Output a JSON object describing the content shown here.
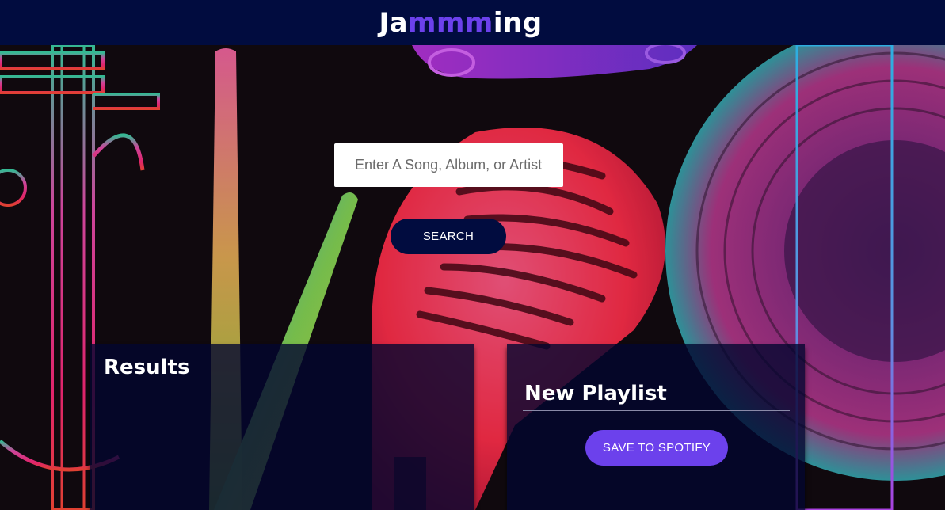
{
  "header": {
    "brand_prefix": "Ja",
    "brand_accent": "mmm",
    "brand_suffix": "ing",
    "background_color": "#010c3f",
    "accent_color": "#6c41ec"
  },
  "search": {
    "placeholder": "Enter A Song, Album, or Artist",
    "value": "",
    "button_label": "SEARCH"
  },
  "results": {
    "title": "Results",
    "tracks": []
  },
  "playlist": {
    "name_value": "New Playlist",
    "tracks": [],
    "save_label": "SAVE TO SPOTIFY"
  },
  "background": {
    "icons": [
      "trumpet-icon",
      "drumstick-icon",
      "microphone-icon",
      "vinyl-record-icon",
      "guitar-neck-icon",
      "tambourine-icon"
    ]
  }
}
